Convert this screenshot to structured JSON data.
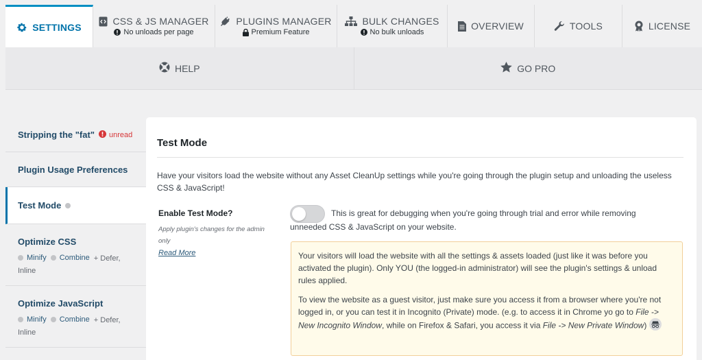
{
  "tabs": [
    {
      "label": "SETTINGS",
      "icon": "gear-icon",
      "active": true,
      "sub": ""
    },
    {
      "label": "CSS & JS MANAGER",
      "icon": "code-file-icon",
      "sub": "No unloads per page",
      "sub_icon": "info-circle-icon"
    },
    {
      "label": "PLUGINS MANAGER",
      "icon": "plugin-icon",
      "sub": "Premium Feature",
      "sub_icon": "lock-icon"
    },
    {
      "label": "BULK CHANGES",
      "icon": "sitemap-icon",
      "sub": "No bulk unloads",
      "sub_icon": "info-circle-icon"
    },
    {
      "label": "OVERVIEW",
      "icon": "document-icon",
      "sub": ""
    },
    {
      "label": "TOOLS",
      "icon": "wrench-icon",
      "sub": ""
    },
    {
      "label": "LICENSE",
      "icon": "award-icon",
      "sub": ""
    }
  ],
  "secondary_tabs": [
    {
      "label": "HELP",
      "icon": "lifebuoy-icon"
    },
    {
      "label": "GO PRO",
      "icon": "star-icon"
    }
  ],
  "sidenav": [
    {
      "label": "Stripping the \"fat\"",
      "badge": "unread"
    },
    {
      "label": "Plugin Usage Preferences"
    },
    {
      "label": "Test Mode",
      "active": true
    },
    {
      "label": "Optimize CSS",
      "opt1": "Minify",
      "opt2": "Combine",
      "extra1": "+ Defer,",
      "extra2": "Inline"
    },
    {
      "label": "Optimize JavaScript",
      "opt1": "Minify",
      "opt2": "Combine",
      "extra1": "+ Defer,",
      "extra2": "Inline"
    }
  ],
  "panel": {
    "title": "Test Mode",
    "description": "Have your visitors load the website without any Asset CleanUp settings while you're going through the plugin setup and unloading the useless CSS & JavaScript!",
    "field_label": "Enable Test Mode?",
    "field_hint": "Apply plugin's changes for the admin only",
    "read_more": "Read More",
    "toggle_on": false,
    "toggle_text": "This is great for debugging when you're going through trial and error while removing unneeded CSS & JavaScript on your website.",
    "notice_p1": "Your visitors will load the website with all the settings & assets loaded (just like it was before you activated the plugin). Only YOU (the logged-in administrator) will see the plugin's settings & unload rules applied.",
    "notice_p2_a": "To view the website as a guest visitor, just make sure you access it from a browser where you're not logged in, or you can test it in Incognito (Private) mode. (e.g. to access it in Chrome yo go to ",
    "notice_p2_em1": "File -> New Incognito Window",
    "notice_p2_b": ", while on Firefox & Safari, you access it via ",
    "notice_p2_em2": "File -> New Private Window",
    "notice_p2_c": ")"
  },
  "colors": {
    "accent": "#0073aa",
    "active_border": "#008ec2",
    "unread": "#d63638",
    "notice_bg": "#fffbea",
    "notice_border": "#f2cf99"
  }
}
